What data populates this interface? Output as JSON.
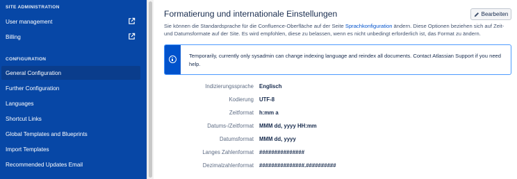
{
  "sidebar": {
    "section1_title": "SITE ADMINISTRATION",
    "section1_items": [
      {
        "label": "User management",
        "icon": "external-link-icon"
      },
      {
        "label": "Billing",
        "icon": "external-link-icon"
      }
    ],
    "section2_title": "CONFIGURATION",
    "section2_items": [
      {
        "label": "General Configuration",
        "active": true
      },
      {
        "label": "Further Configuration"
      },
      {
        "label": "Languages"
      },
      {
        "label": "Shortcut Links"
      },
      {
        "label": "Global Templates and Blueprints"
      },
      {
        "label": "Import Templates"
      },
      {
        "label": "Recommended Updates Email"
      }
    ]
  },
  "main": {
    "title": "Formatierung und internationale Einstellungen",
    "edit_label": "Bearbeiten",
    "desc_before": "Sie können die Standardsprache für die Confluence-Oberfläche auf der Seite ",
    "desc_link": "Sprachkonfiguration",
    "desc_after": " ändern. Diese Optionen beziehen sich auf Zeit- und Datumsformate auf der Site. Es wird empfohlen, diese zu belassen, wenn es nicht unbedingt erforderlich ist, das Format zu ändern.",
    "info_message": "Temporarily, currently only sysadmin can change indexing language and reindex all documents. Contact Atlassian Support if you need help.",
    "settings": [
      {
        "label": "Indizierungssprache",
        "value": "Englisch"
      },
      {
        "label": "Kodierung",
        "value": "UTF-8"
      },
      {
        "label": "Zeitformat",
        "value": "h:mm a"
      },
      {
        "label": "Datums-/Zeitformat",
        "value": "MMM dd, yyyy HH:mm"
      },
      {
        "label": "Datumsformat",
        "value": "MMM dd, yyyy"
      },
      {
        "label": "Langes Zahlenformat",
        "value": "###############"
      },
      {
        "label": "Dezimalzahlenformat",
        "value": "###############.##########"
      }
    ]
  },
  "colors": {
    "sidebar_bg": "#0747a6",
    "active_item_bg": "#0a3d8c",
    "link": "#0052cc",
    "info_border": "#4c9aff"
  }
}
